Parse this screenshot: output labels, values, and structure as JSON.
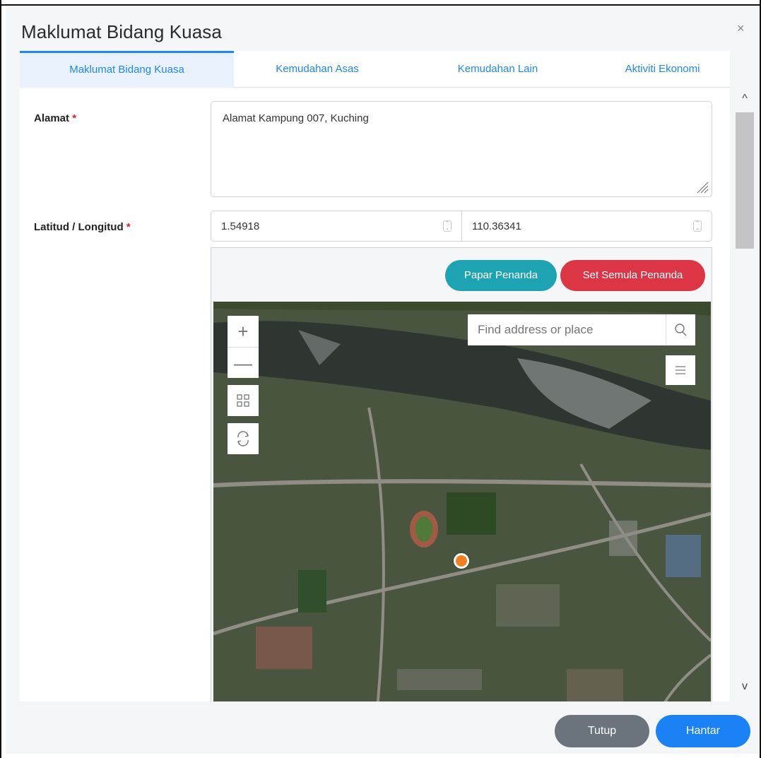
{
  "dialog": {
    "title": "Maklumat Bidang Kuasa",
    "close_glyph": "×"
  },
  "tabs": [
    {
      "label": "Maklumat Bidang Kuasa",
      "active": true
    },
    {
      "label": "Kemudahan Asas",
      "active": false
    },
    {
      "label": "Kemudahan Lain",
      "active": false
    },
    {
      "label": "Aktiviti Ekonomi",
      "active": false
    }
  ],
  "form": {
    "address": {
      "label": "Alamat",
      "required_mark": "*",
      "value": "Alamat Kampung 007, Kuching"
    },
    "coordinates": {
      "label": "Latitud / Longitud",
      "required_mark": "*",
      "latitude": "1.54918",
      "longitude": "110.36341"
    }
  },
  "map_panel": {
    "show_marker_label": "Papar Penanda",
    "reset_marker_label": "Set Semula Penanda",
    "search_placeholder": "Find address or place",
    "zoom_in_glyph": "+",
    "zoom_out_glyph": "—",
    "icons": [
      "zoom-in-icon",
      "zoom-out-icon",
      "fullscreen-icon",
      "refresh-icon",
      "search-icon",
      "layers-icon",
      "location-marker-icon"
    ]
  },
  "scrollbar": {
    "up_glyph": "^",
    "down_glyph": "v"
  },
  "footer": {
    "close_label": "Tutup",
    "submit_label": "Hantar"
  },
  "colors": {
    "tab_text": "#1f87f0",
    "show_marker_btn": "#1ea3b3",
    "reset_marker_btn": "#dc3545",
    "close_btn": "#6b747d",
    "submit_btn": "#1a82f5",
    "required": "#d8232a",
    "marker": "#f08022"
  }
}
